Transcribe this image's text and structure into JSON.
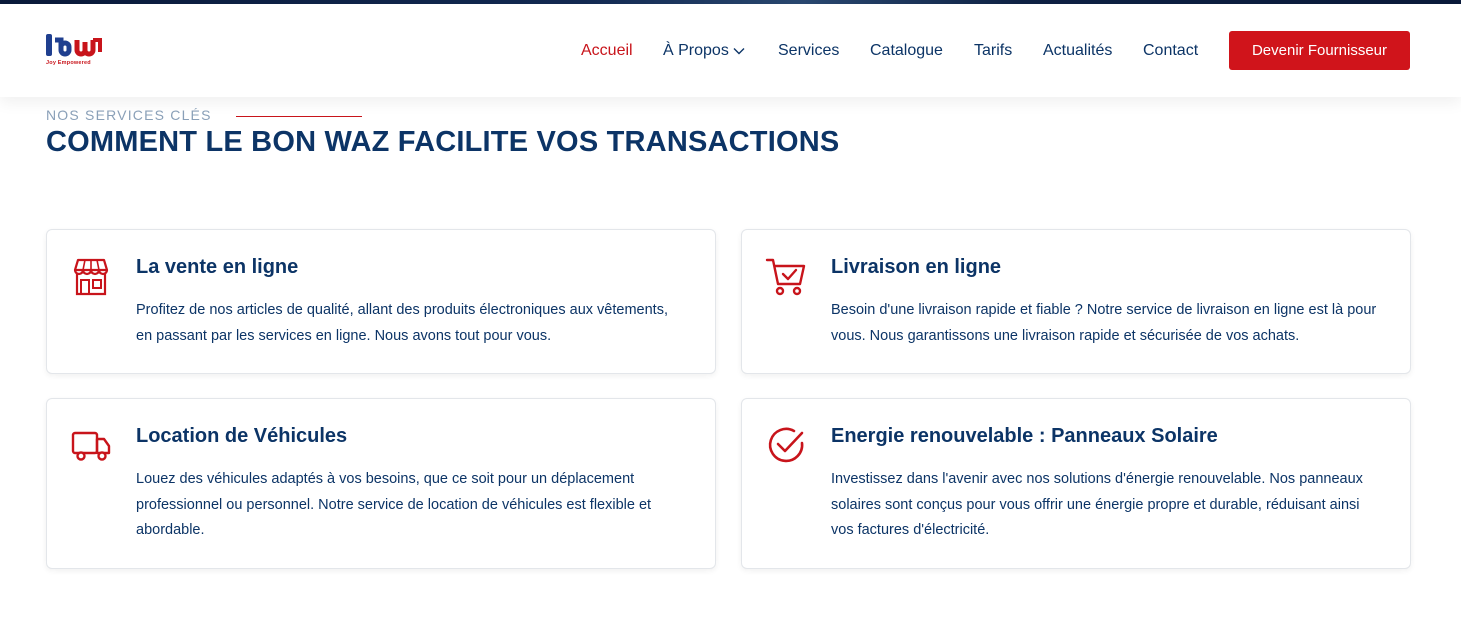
{
  "logo": {
    "name": "lbw",
    "tagline": "Joy Empowered"
  },
  "nav": {
    "items": [
      {
        "label": "Accueil",
        "active": true
      },
      {
        "label": "À Propos",
        "dropdown": true
      },
      {
        "label": "Services"
      },
      {
        "label": "Catalogue"
      },
      {
        "label": "Tarifs"
      },
      {
        "label": "Actualités"
      },
      {
        "label": "Contact"
      }
    ],
    "cta_label": "Devenir Fournisseur"
  },
  "section": {
    "eyebrow": "NOS SERVICES CLÉS",
    "title": "COMMENT LE BON WAZ FACILITE VOS TRANSACTIONS"
  },
  "services": [
    {
      "icon": "storefront-icon",
      "title": "La vente en ligne",
      "desc": "Profitez de nos articles de qualité, allant des produits électroniques aux vêtements, en passant par les services en ligne. Nous avons tout pour vous."
    },
    {
      "icon": "shopping-cart-check-icon",
      "title": "Livraison en ligne",
      "desc": "Besoin d'une livraison rapide et fiable ? Notre service de livraison en ligne est là pour vous. Nous garantissons une livraison rapide et sécurisée de vos achats."
    },
    {
      "icon": "truck-icon",
      "title": "Location de Véhicules",
      "desc": "Louez des véhicules adaptés à vos besoins, que ce soit pour un déplacement professionnel ou personnel. Notre service de location de véhicules est flexible et abordable."
    },
    {
      "icon": "check-circle-icon",
      "title": "Energie renouvelable : Panneaux Solaire",
      "desc": "Investissez dans l'avenir avec nos solutions d'énergie renouvelable. Nos panneaux solaires sont conçus pour vous offrir une énergie propre et durable, réduisant ainsi vos factures d'électricité."
    }
  ],
  "colors": {
    "brand_blue": "#0c3466",
    "accent_red": "#d0141b",
    "eyebrow_gray": "#8aa0b8"
  }
}
